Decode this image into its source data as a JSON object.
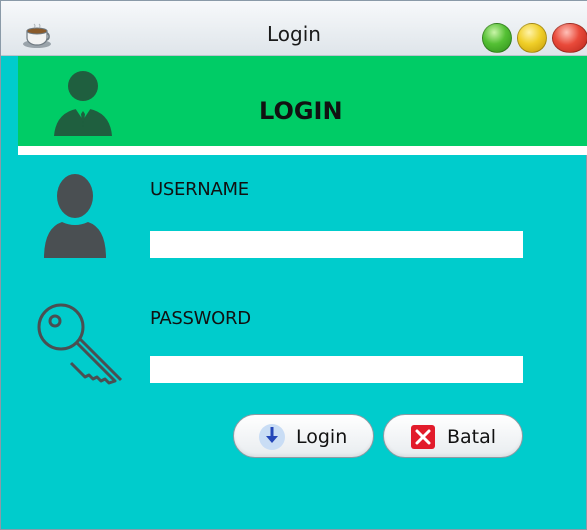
{
  "window": {
    "title": "Login",
    "app_icon": "coffee-cup-icon",
    "controls": [
      "maximize",
      "minimize",
      "close"
    ]
  },
  "header": {
    "title": "LOGIN",
    "avatar_icon": "business-user-icon",
    "background": "#00cc66"
  },
  "form": {
    "background": "#00cccc",
    "username_label": "USERNAME",
    "username_value": "",
    "username_placeholder": "",
    "username_icon": "user-silhouette-icon",
    "password_label": "PASSWORD",
    "password_value": "",
    "password_placeholder": "",
    "password_icon": "key-icon"
  },
  "buttons": {
    "login_label": "Login",
    "login_icon": "arrow-down-icon",
    "cancel_label": "Batal",
    "cancel_icon": "red-x-icon"
  }
}
